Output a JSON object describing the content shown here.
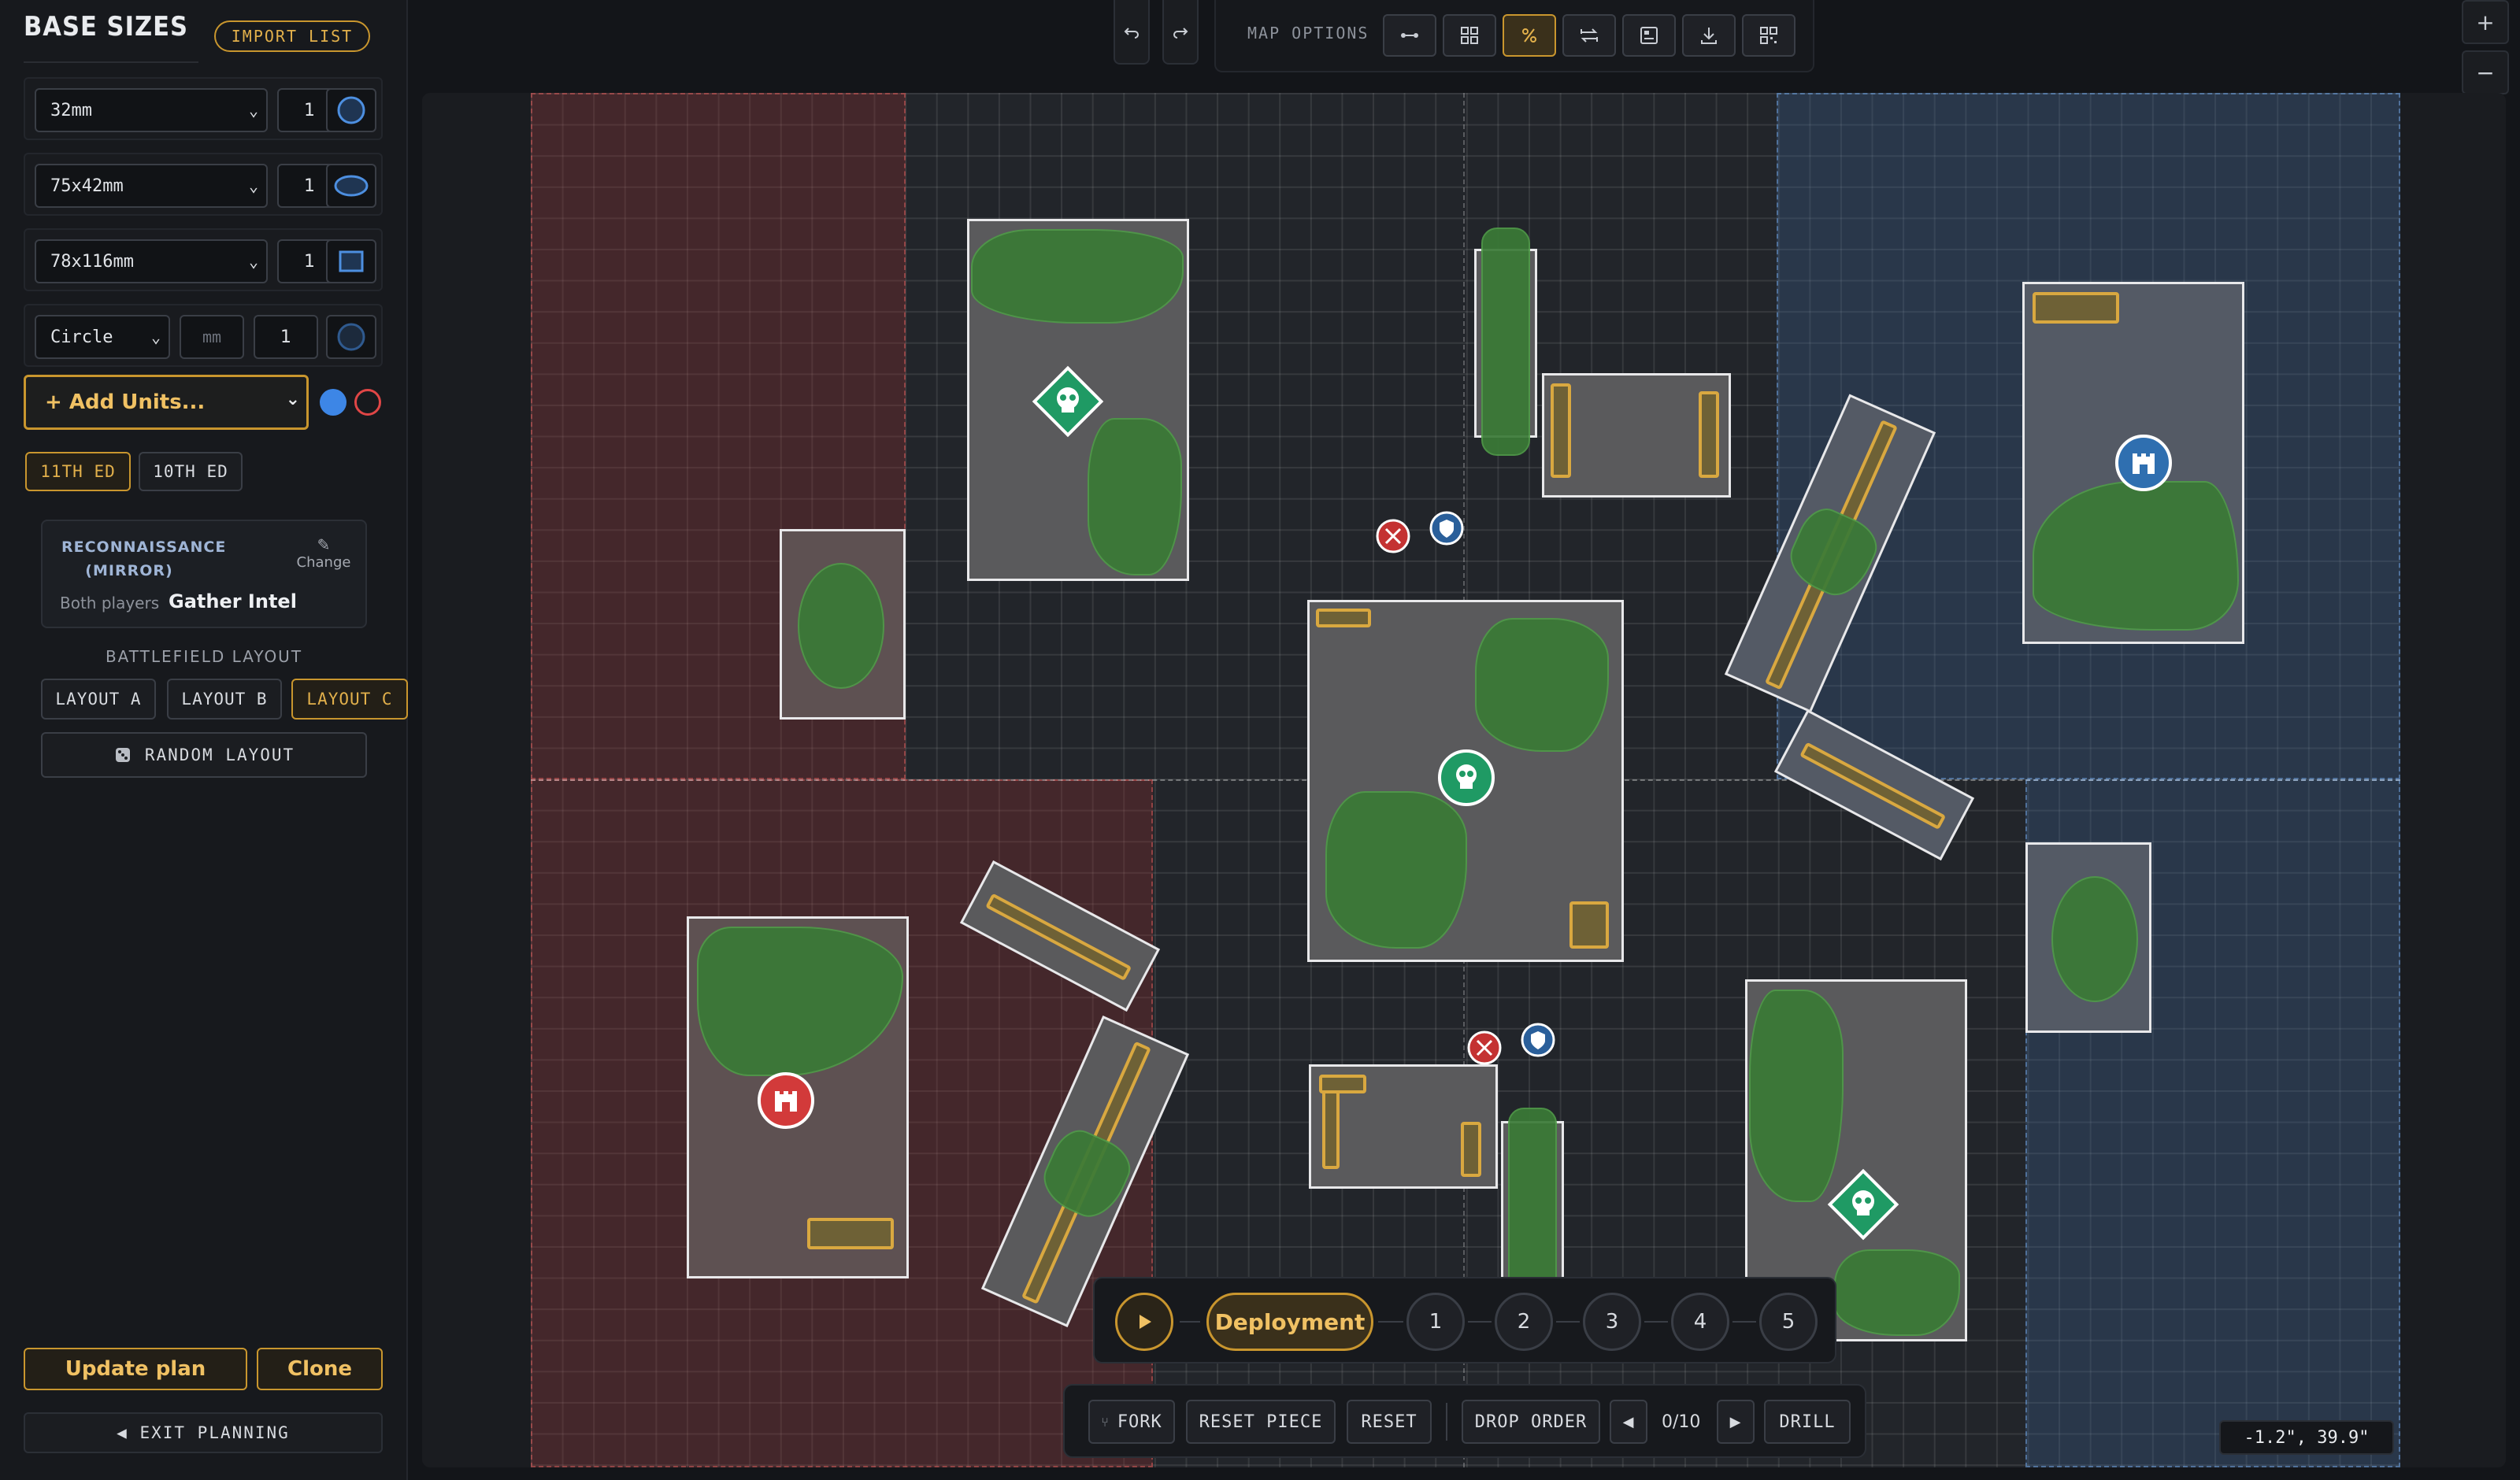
{
  "sidebar": {
    "title": "BASE SIZES",
    "import_label": "IMPORT LIST",
    "bases": [
      {
        "size": "32mm",
        "qty": "1",
        "shape": "circle-icon"
      },
      {
        "size": "75x42mm",
        "qty": "1",
        "shape": "oval-icon"
      },
      {
        "size": "78x116mm",
        "qty": "1",
        "shape": "rectangle-icon"
      },
      {
        "size": "Circle",
        "mm_placeholder": "mm",
        "qty": "1",
        "shape": "circle-icon"
      }
    ],
    "add_units_label": "+ Add Units...",
    "editions": [
      "11TH ED",
      "10TH ED"
    ],
    "active_edition": "11TH ED",
    "mission": {
      "title": "RECONNAISSANCE (MIRROR)",
      "change_label": "Change",
      "both_players_label": "Both players",
      "name": "Gather Intel"
    },
    "battlefield_layout_label": "BATTLEFIELD LAYOUT",
    "layouts": [
      "LAYOUT A",
      "LAYOUT B",
      "LAYOUT C"
    ],
    "active_layout": "LAYOUT C",
    "random_layout_label": "RANDOM LAYOUT",
    "update_label": "Update plan",
    "clone_label": "Clone",
    "exit_label": "◀ EXIT PLANNING"
  },
  "toolbar": {
    "undo_icon": "undo-icon",
    "redo_icon": "redo-icon",
    "map_options_label": "MAP OPTIONS",
    "option_icons": [
      "ruler-icon",
      "grid-icon",
      "zone-toggle-icon",
      "mirror-icon",
      "objective-layout-icon",
      "download-icon",
      "qr-code-icon"
    ],
    "active_option": "zone-toggle-icon"
  },
  "zoom": {
    "in": "+",
    "out": "−"
  },
  "map": {
    "colors": {
      "red_zone": "#963030",
      "blue_zone": "#3c6496",
      "foliage": "#3a7a36",
      "ruin": "#d9a840",
      "objective_green": "#1f9a64",
      "objective_red": "#d23a3a",
      "objective_blue": "#2f6fb0"
    },
    "coordinate_readout": "-1.2\", 39.9\""
  },
  "timeline": {
    "play_icon": "play-icon",
    "deployment_label": "Deployment",
    "steps": [
      "1",
      "2",
      "3",
      "4",
      "5"
    ],
    "active_step": "Deployment"
  },
  "actions": {
    "fork_label": "FORK",
    "reset_piece_label": "RESET PIECE",
    "reset_label": "RESET",
    "drop_order_label": "DROP ORDER",
    "counter": "0/10",
    "drill_label": "DRILL"
  }
}
